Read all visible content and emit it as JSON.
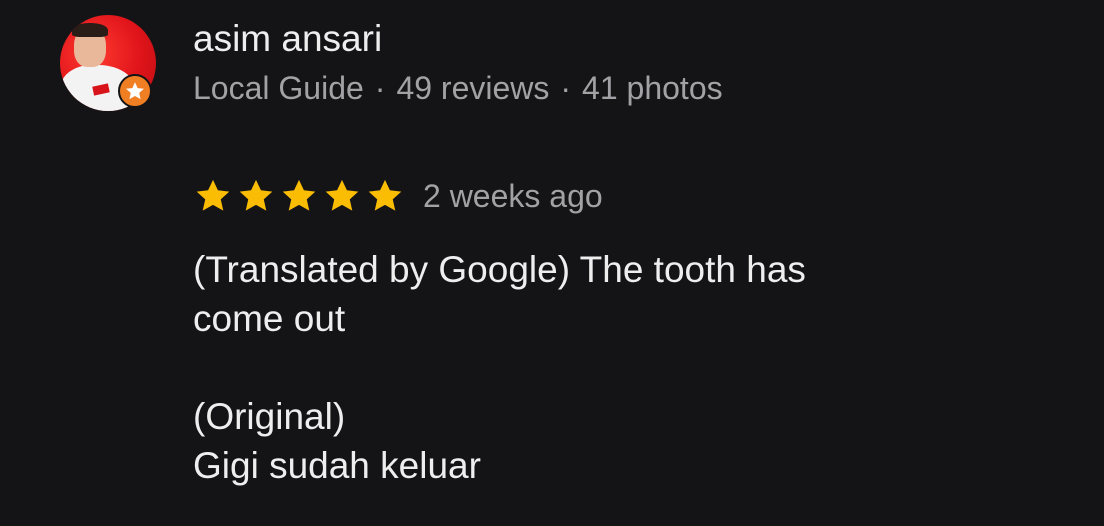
{
  "reviewer": {
    "name": "asim ansari",
    "badge": "Local Guide",
    "separator": "·",
    "reviews": "49 reviews",
    "photos": "41 photos",
    "badge_icon": "star-icon",
    "badge_color": "#f07f24"
  },
  "rating": {
    "stars": 5,
    "max_stars": 5,
    "star_color": "#fbbc04",
    "timestamp": "2 weeks ago"
  },
  "review_text": {
    "translated_line_1": "(Translated by Google) The tooth has",
    "translated_line_2": "come out",
    "original_label": "(Original)",
    "original_text": "Gigi sudah keluar"
  }
}
